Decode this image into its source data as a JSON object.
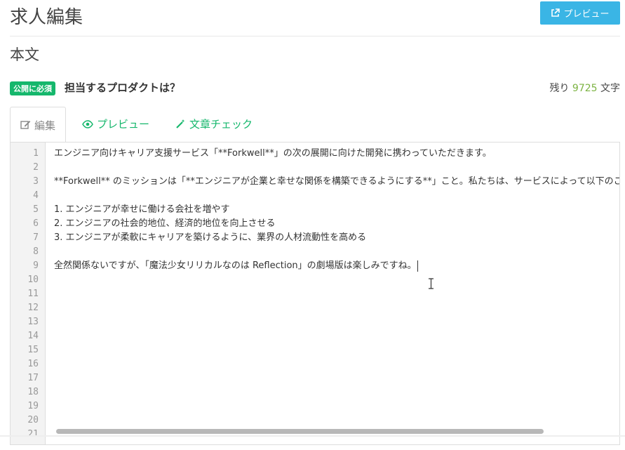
{
  "page": {
    "title": "求人編集",
    "preview_button": "プレビュー"
  },
  "section": {
    "title": "本文"
  },
  "field": {
    "required_badge": "公開に必須",
    "label": "担当するプロダクトは？",
    "remaining_prefix": "残り",
    "remaining_count": "9725",
    "remaining_suffix": "文字"
  },
  "tabs": [
    {
      "label": "編集",
      "icon": "edit-icon",
      "active": true
    },
    {
      "label": "プレビュー",
      "icon": "eye-icon",
      "active": false
    },
    {
      "label": "文章チェック",
      "icon": "magic-wand-icon",
      "active": false
    }
  ],
  "editor": {
    "line_numbers": [
      "1",
      "2",
      "3",
      "4",
      "5",
      "6",
      "7",
      "8",
      "9",
      "10",
      "11",
      "12",
      "13",
      "14",
      "15",
      "16",
      "17",
      "18",
      "19",
      "20",
      "21"
    ],
    "lines": [
      "エンジニア向けキャリア支援サービス「**Forkwell**」の次の展開に向けた開発に携わっていただきます。",
      "",
      "**Forkwell** のミッションは「**エンジニアが企業と幸せな関係を構築できるようにする**」こと。私たちは、サービスによって以下のことを実",
      "",
      "1. エンジニアが幸せに働ける会社を増やす",
      "2. エンジニアの社会的地位、経済的地位を向上させる",
      "3. エンジニアが柔軟にキャリアを築けるように、業界の人材流動性を高める",
      "",
      "全然関係ないですが、「魔法少女リリカルなのは Reflection」の劇場版は楽しみですね。"
    ]
  },
  "colors": {
    "accent_green": "#15b76c",
    "preview_blue": "#3ab5e5",
    "count_green": "#7cb342"
  }
}
